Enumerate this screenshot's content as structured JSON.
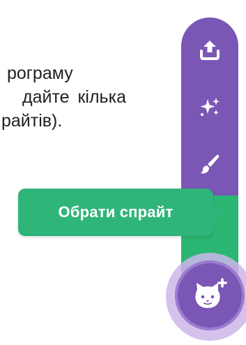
{
  "document_text": {
    "line1": "рограму",
    "line2": "дайте кілька",
    "line3": "райтів)."
  },
  "sprite_menu": {
    "tooltip_label": "Обрати спрайт",
    "buttons": [
      {
        "icon": "upload-icon"
      },
      {
        "icon": "sparkle-icon"
      },
      {
        "icon": "paintbrush-icon"
      }
    ],
    "main_button_icon": "cat-plus-icon"
  },
  "colors": {
    "menu_purple": "#7a56b5",
    "halo_lavender": "#cdb7ea",
    "tooltip_green": "#2fb47a",
    "text_dark": "#1f1f1f",
    "icon_white": "#ffffff"
  }
}
